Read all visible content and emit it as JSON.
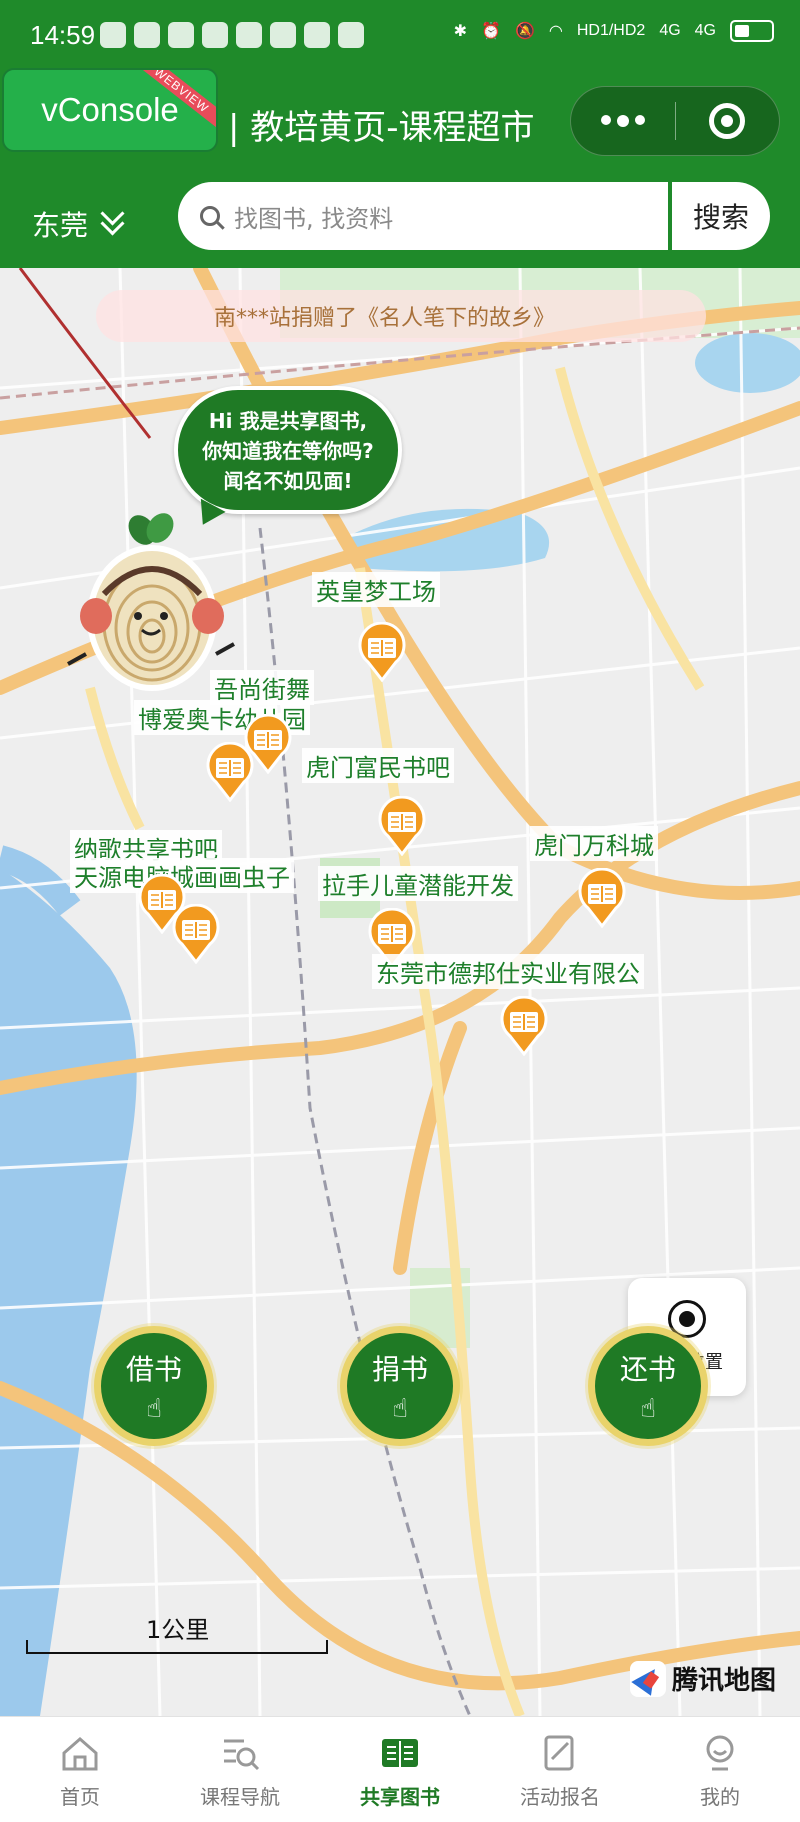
{
  "status_bar": {
    "time": "14:59",
    "net1": "HD1",
    "net2": "HD2",
    "signal1": "4G",
    "signal2": "4G"
  },
  "header": {
    "vconsole_label": "vConsole",
    "vconsole_ribbon": "WEBVIEW",
    "title": "| 教培黄页-课程超市",
    "city": "东莞",
    "search_placeholder": "找图书, 找资料",
    "search_button": "搜索"
  },
  "map": {
    "ticker": "南***站捐赠了《名人笔下的故乡》",
    "bubble_lines": [
      "Hi 我是共享图书,",
      "你知道我在等你吗?",
      "闻名不如见面!"
    ],
    "pois": [
      "英皇梦工场",
      "吾尚街舞",
      "博爱奥卡幼儿园",
      "虎门富民书吧",
      "纳歌共享书吧",
      "天源电脑城画画虫子",
      "拉手儿童潜能开发",
      "虎门万科城",
      "东莞市德邦仕实业有限公"
    ],
    "locate_label": "当前位置",
    "scale_label": "1公里",
    "provider": "腾讯地图"
  },
  "actions": {
    "borrow": "借书",
    "donate": "捐书",
    "return": "还书"
  },
  "tabbar": [
    {
      "label": "首页",
      "icon": "home-icon",
      "active": false
    },
    {
      "label": "课程导航",
      "icon": "course-search-icon",
      "active": false
    },
    {
      "label": "共享图书",
      "icon": "book-icon",
      "active": true
    },
    {
      "label": "活动报名",
      "icon": "edit-form-icon",
      "active": false
    },
    {
      "label": "我的",
      "icon": "profile-icon",
      "active": false
    }
  ],
  "colors": {
    "brand_green": "#1f8a2a",
    "poi_orange": "#f29a1f",
    "action_ring": "#e9d36b"
  }
}
